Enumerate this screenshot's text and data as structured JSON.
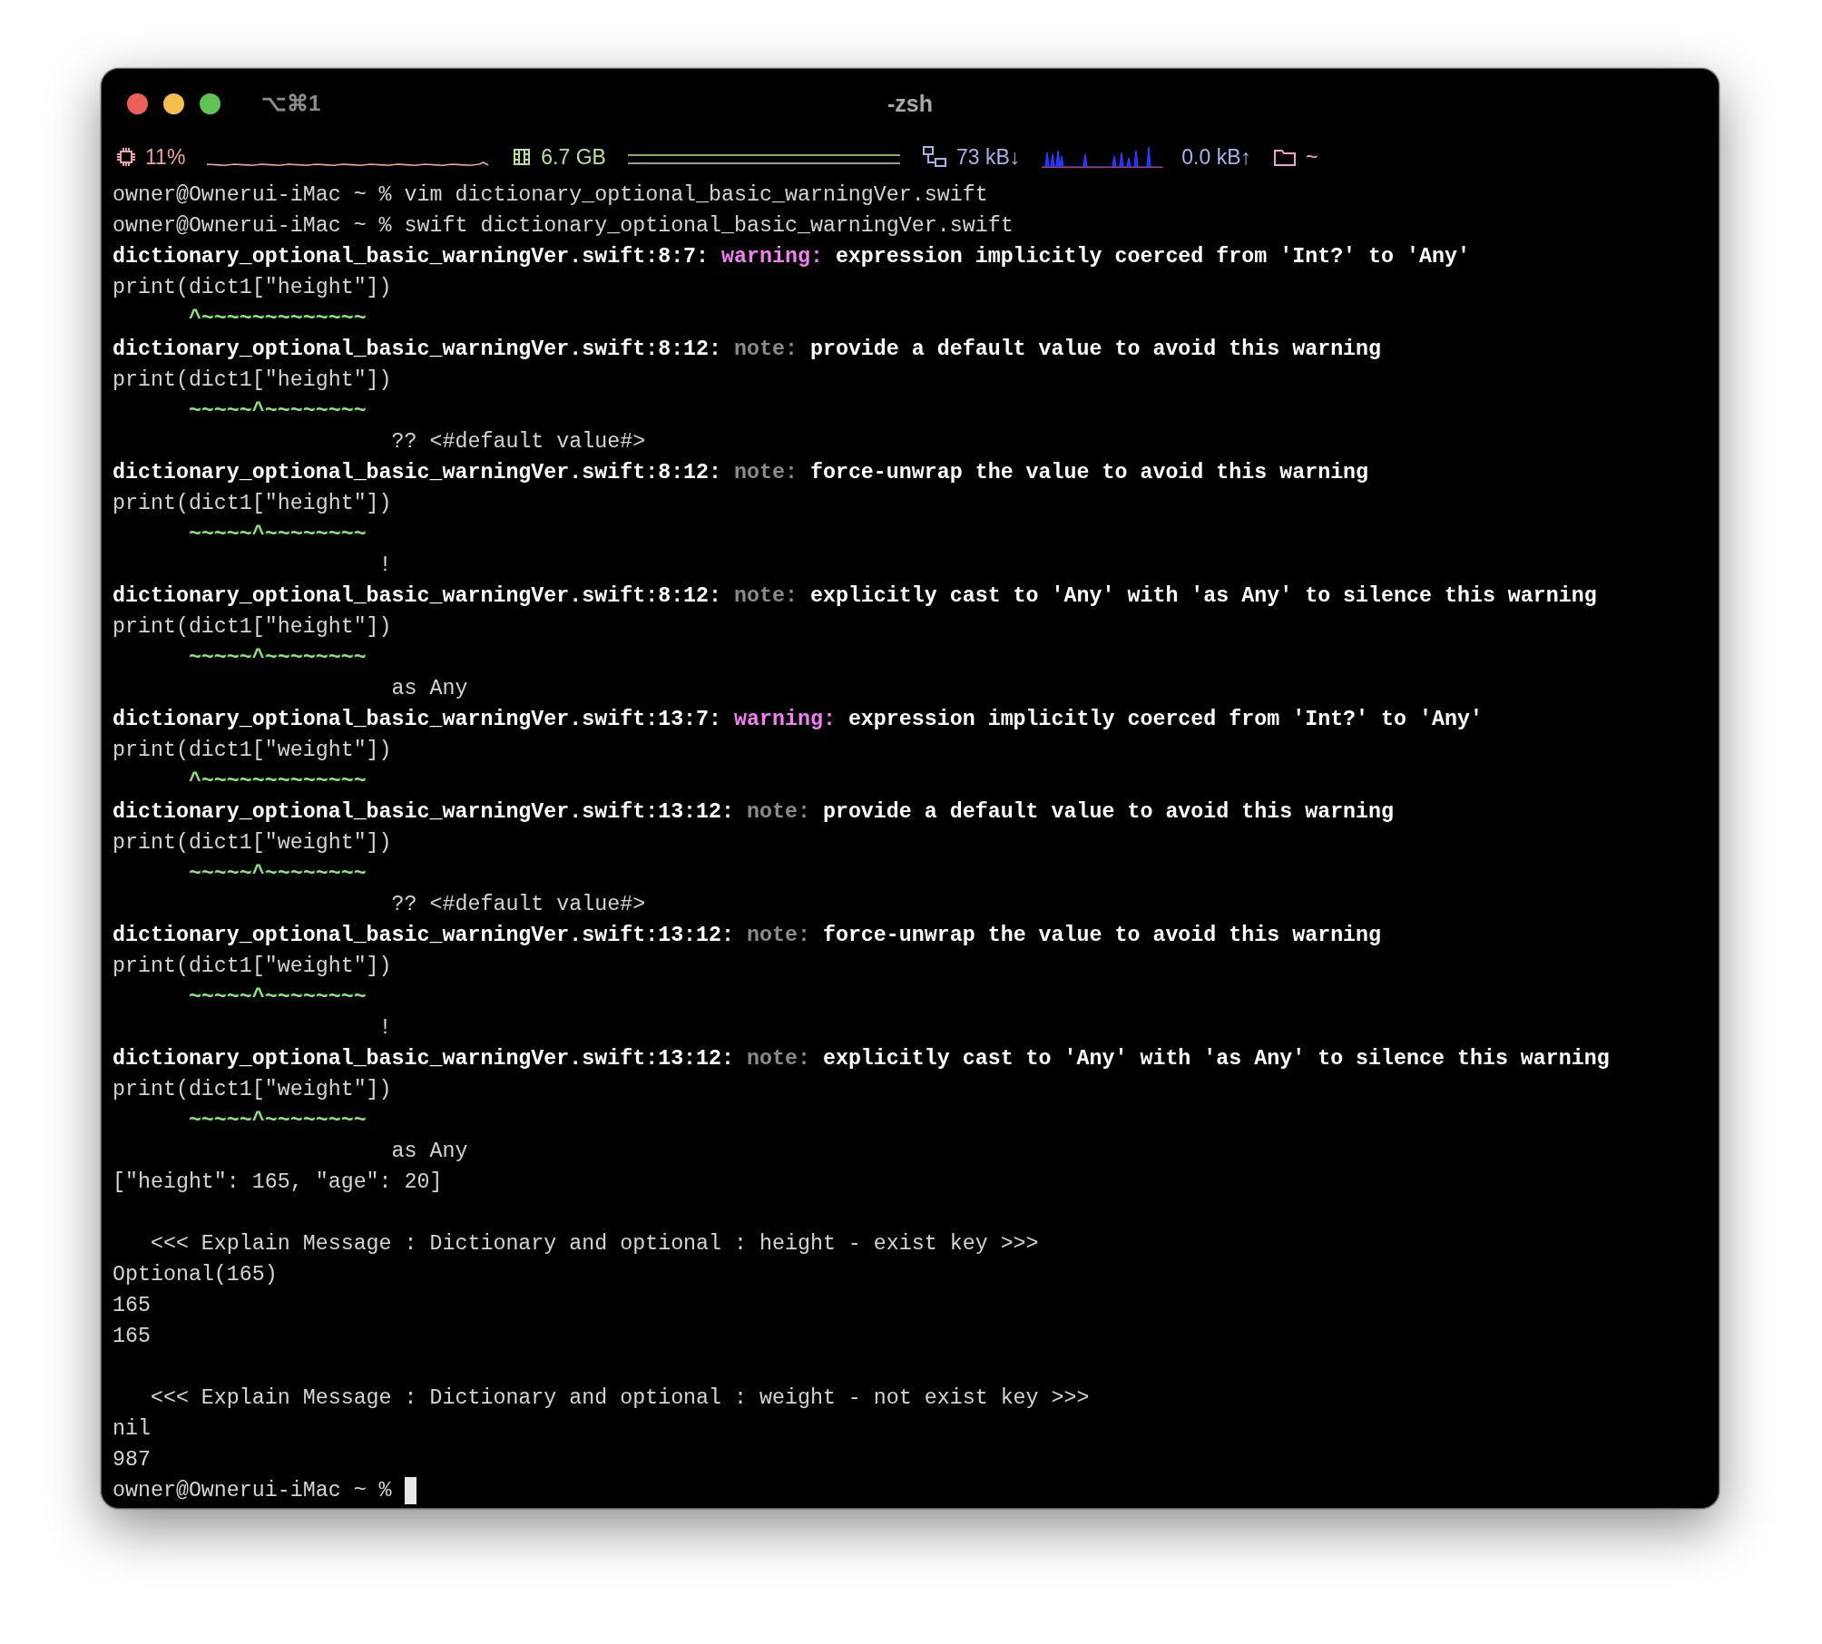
{
  "window": {
    "shortcut": "⌥⌘1",
    "title": "-zsh"
  },
  "status_bar": [
    {
      "kind": "cpu",
      "value": "11%",
      "color": "#f0a0a0"
    },
    {
      "kind": "memory",
      "value": "6.7 GB",
      "color": "#b5e38e"
    },
    {
      "kind": "network",
      "value_down": "73 kB↓",
      "value_up": "0.0 kB↑",
      "color": "#a3b3f0"
    },
    {
      "kind": "directory",
      "value": "~",
      "color": "#f0a0d0"
    }
  ],
  "lines": [
    {
      "kind": "text",
      "segments": [
        {
          "kind": "plain",
          "text": "owner@Ownerui-iMac ~ % vim dictionary_optional_basic_warningVer.swift"
        }
      ]
    },
    {
      "kind": "text",
      "segments": [
        {
          "kind": "plain",
          "text": "owner@Ownerui-iMac ~ % swift dictionary_optional_basic_warningVer.swift"
        }
      ]
    },
    {
      "kind": "text",
      "segments": [
        {
          "kind": "bold",
          "text": "dictionary_optional_basic_warningVer.swift:8:7: "
        },
        {
          "kind": "warning",
          "text": "warning: "
        },
        {
          "kind": "bold",
          "text": "expression implicitly coerced from 'Int?' to 'Any'"
        }
      ]
    },
    {
      "kind": "text",
      "segments": [
        {
          "kind": "plain",
          "text": "print(dict1[\"height\"])"
        }
      ]
    },
    {
      "kind": "text",
      "segments": [
        {
          "kind": "caret",
          "text": "      ^~~~~~~~~~~~~~"
        }
      ]
    },
    {
      "kind": "text",
      "segments": [
        {
          "kind": "bold",
          "text": "dictionary_optional_basic_warningVer.swift:8:12: "
        },
        {
          "kind": "note",
          "text": "note: "
        },
        {
          "kind": "bold",
          "text": "provide a default value to avoid this warning"
        }
      ]
    },
    {
      "kind": "text",
      "segments": [
        {
          "kind": "plain",
          "text": "print(dict1[\"height\"])"
        }
      ]
    },
    {
      "kind": "text",
      "segments": [
        {
          "kind": "caret",
          "text": "      ~~~~~^~~~~~~~~"
        }
      ]
    },
    {
      "kind": "text",
      "segments": [
        {
          "kind": "plain",
          "text": "                      ?? <#default value#>"
        }
      ]
    },
    {
      "kind": "text",
      "segments": [
        {
          "kind": "bold",
          "text": "dictionary_optional_basic_warningVer.swift:8:12: "
        },
        {
          "kind": "note",
          "text": "note: "
        },
        {
          "kind": "bold",
          "text": "force-unwrap the value to avoid this warning"
        }
      ]
    },
    {
      "kind": "text",
      "segments": [
        {
          "kind": "plain",
          "text": "print(dict1[\"height\"])"
        }
      ]
    },
    {
      "kind": "text",
      "segments": [
        {
          "kind": "caret",
          "text": "      ~~~~~^~~~~~~~~"
        }
      ]
    },
    {
      "kind": "text",
      "segments": [
        {
          "kind": "plain",
          "text": "                     !"
        }
      ]
    },
    {
      "kind": "text",
      "segments": [
        {
          "kind": "bold",
          "text": "dictionary_optional_basic_warningVer.swift:8:12: "
        },
        {
          "kind": "note",
          "text": "note: "
        },
        {
          "kind": "bold",
          "text": "explicitly cast to 'Any' with 'as Any' to silence this warning"
        }
      ]
    },
    {
      "kind": "text",
      "segments": [
        {
          "kind": "plain",
          "text": "print(dict1[\"height\"])"
        }
      ]
    },
    {
      "kind": "text",
      "segments": [
        {
          "kind": "caret",
          "text": "      ~~~~~^~~~~~~~~"
        }
      ]
    },
    {
      "kind": "text",
      "segments": [
        {
          "kind": "plain",
          "text": "                      as Any"
        }
      ]
    },
    {
      "kind": "text",
      "segments": [
        {
          "kind": "bold",
          "text": "dictionary_optional_basic_warningVer.swift:13:7: "
        },
        {
          "kind": "warning",
          "text": "warning: "
        },
        {
          "kind": "bold",
          "text": "expression implicitly coerced from 'Int?' to 'Any'"
        }
      ]
    },
    {
      "kind": "text",
      "segments": [
        {
          "kind": "plain",
          "text": "print(dict1[\"weight\"])"
        }
      ]
    },
    {
      "kind": "text",
      "segments": [
        {
          "kind": "caret",
          "text": "      ^~~~~~~~~~~~~~"
        }
      ]
    },
    {
      "kind": "text",
      "segments": [
        {
          "kind": "bold",
          "text": "dictionary_optional_basic_warningVer.swift:13:12: "
        },
        {
          "kind": "note",
          "text": "note: "
        },
        {
          "kind": "bold",
          "text": "provide a default value to avoid this warning"
        }
      ]
    },
    {
      "kind": "text",
      "segments": [
        {
          "kind": "plain",
          "text": "print(dict1[\"weight\"])"
        }
      ]
    },
    {
      "kind": "text",
      "segments": [
        {
          "kind": "caret",
          "text": "      ~~~~~^~~~~~~~~"
        }
      ]
    },
    {
      "kind": "text",
      "segments": [
        {
          "kind": "plain",
          "text": "                      ?? <#default value#>"
        }
      ]
    },
    {
      "kind": "text",
      "segments": [
        {
          "kind": "bold",
          "text": "dictionary_optional_basic_warningVer.swift:13:12: "
        },
        {
          "kind": "note",
          "text": "note: "
        },
        {
          "kind": "bold",
          "text": "force-unwrap the value to avoid this warning"
        }
      ]
    },
    {
      "kind": "text",
      "segments": [
        {
          "kind": "plain",
          "text": "print(dict1[\"weight\"])"
        }
      ]
    },
    {
      "kind": "text",
      "segments": [
        {
          "kind": "caret",
          "text": "      ~~~~~^~~~~~~~~"
        }
      ]
    },
    {
      "kind": "text",
      "segments": [
        {
          "kind": "plain",
          "text": "                     !"
        }
      ]
    },
    {
      "kind": "text",
      "segments": [
        {
          "kind": "bold",
          "text": "dictionary_optional_basic_warningVer.swift:13:12: "
        },
        {
          "kind": "note",
          "text": "note: "
        },
        {
          "kind": "bold",
          "text": "explicitly cast to 'Any' with 'as Any' to silence this warning"
        }
      ]
    },
    {
      "kind": "text",
      "segments": [
        {
          "kind": "plain",
          "text": "print(dict1[\"weight\"])"
        }
      ]
    },
    {
      "kind": "text",
      "segments": [
        {
          "kind": "caret",
          "text": "      ~~~~~^~~~~~~~~"
        }
      ]
    },
    {
      "kind": "text",
      "segments": [
        {
          "kind": "plain",
          "text": "                      as Any"
        }
      ]
    },
    {
      "kind": "text",
      "segments": [
        {
          "kind": "plain",
          "text": "[\"height\": 165, \"age\": 20]"
        }
      ]
    },
    {
      "kind": "blank"
    },
    {
      "kind": "text",
      "segments": [
        {
          "kind": "plain",
          "text": "   <<< Explain Message : Dictionary and optional : height - exist key >>>"
        }
      ]
    },
    {
      "kind": "text",
      "segments": [
        {
          "kind": "plain",
          "text": "Optional(165)"
        }
      ]
    },
    {
      "kind": "text",
      "segments": [
        {
          "kind": "plain",
          "text": "165"
        }
      ]
    },
    {
      "kind": "text",
      "segments": [
        {
          "kind": "plain",
          "text": "165"
        }
      ]
    },
    {
      "kind": "blank"
    },
    {
      "kind": "text",
      "segments": [
        {
          "kind": "plain",
          "text": "   <<< Explain Message : Dictionary and optional : weight - not exist key >>>"
        }
      ]
    },
    {
      "kind": "text",
      "segments": [
        {
          "kind": "plain",
          "text": "nil"
        }
      ]
    },
    {
      "kind": "text",
      "segments": [
        {
          "kind": "plain",
          "text": "987"
        }
      ]
    },
    {
      "kind": "text",
      "cursor": true,
      "segments": [
        {
          "kind": "plain",
          "text": "owner@Ownerui-iMac ~ % "
        }
      ]
    }
  ]
}
